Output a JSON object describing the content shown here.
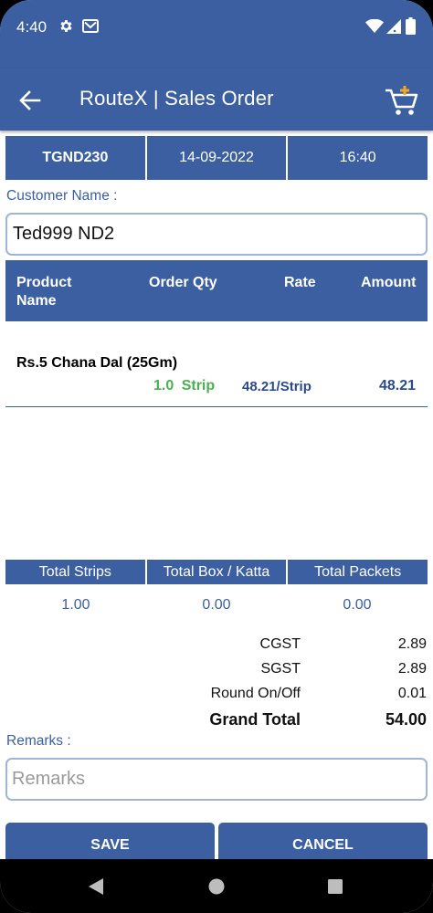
{
  "status_bar": {
    "time": "4:40",
    "icons": [
      "gear-icon",
      "gmail-icon",
      "wifi-icon",
      "signal-icon",
      "battery-icon"
    ]
  },
  "app_bar": {
    "title": "RouteX | Sales Order",
    "icons": [
      "back-arrow-icon",
      "add-to-cart-icon"
    ]
  },
  "order_info": {
    "code": "TGND230",
    "date": "14-09-2022",
    "time": "16:40"
  },
  "customer": {
    "label": "Customer Name :",
    "value": "Ted999 ND2"
  },
  "table": {
    "headers": {
      "product_name": "Product Name",
      "order_qty": "Order Qty",
      "rate": "Rate",
      "amount": "Amount"
    },
    "rows": [
      {
        "name": "Rs.5 Chana Dal (25Gm)",
        "qty": "1.0  Strip",
        "rate": "48.21/Strip",
        "amount": "48.21"
      }
    ]
  },
  "totals": {
    "headers": [
      "Total Strips",
      "Total Box / Katta",
      "Total Packets"
    ],
    "values": [
      "1.00",
      "0.00",
      "0.00"
    ]
  },
  "summary": {
    "cgst_label": "CGST",
    "cgst": "2.89",
    "sgst_label": "SGST",
    "sgst": "2.89",
    "round_label": "Round On/Off",
    "round": "0.01",
    "grand_label": "Grand Total",
    "grand": "54.00"
  },
  "remarks": {
    "label": "Remarks :",
    "placeholder": "Remarks"
  },
  "buttons": {
    "save": "SAVE",
    "cancel": "CANCEL"
  },
  "colors": {
    "primary": "#3b5fa0",
    "qty_green": "#4caf50",
    "cart_accent": "#f5a623"
  }
}
